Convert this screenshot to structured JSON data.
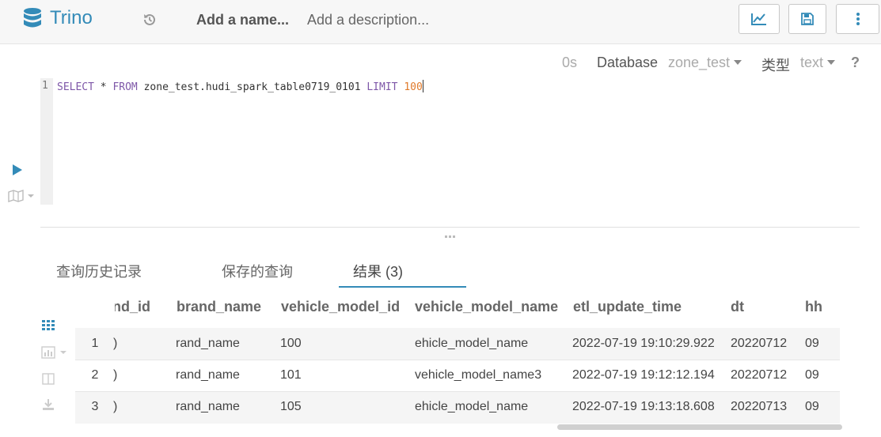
{
  "app": {
    "title": "Trino",
    "icon": "database-icon"
  },
  "header": {
    "name_placeholder": "Add a name...",
    "description_placeholder": "Add a description...",
    "buttons": [
      {
        "name": "chart-button",
        "icon": "line-chart-icon"
      },
      {
        "name": "save-button",
        "icon": "save-icon"
      },
      {
        "name": "more-button",
        "icon": "vertical-dots-icon"
      }
    ]
  },
  "editor": {
    "elapsed": "0s",
    "database_label": "Database",
    "database_value": "zone_test",
    "type_label": "类型",
    "type_value": "text",
    "help": "?",
    "line_number": "1",
    "query_parts": {
      "select": "SELECT",
      "star": " * ",
      "from": "FROM",
      "table": " zone_test.hudi_spark_table0719_0101 ",
      "limit": "LIMIT",
      "space": " ",
      "limit_value": "100"
    }
  },
  "tabs": [
    {
      "label": "查询历史记录",
      "active": false
    },
    {
      "label": "保存的查询",
      "active": false
    },
    {
      "label": "结果 (3)",
      "active": true
    }
  ],
  "results": {
    "columns": [
      "and_id",
      "brand_name",
      "vehicle_model_id",
      "vehicle_model_name",
      "etl_update_time",
      "dt",
      "hh"
    ],
    "rows": [
      {
        "num": "1",
        "cells": [
          ")",
          "rand_name",
          "100",
          "ehicle_model_name",
          "2022-07-19 19:10:29.922",
          "20220712",
          "09"
        ]
      },
      {
        "num": "2",
        "cells": [
          ")",
          "rand_name",
          "101",
          "vehicle_model_name3",
          "2022-07-19 19:12:12.194",
          "20220712",
          "09"
        ]
      },
      {
        "num": "3",
        "cells": [
          ")",
          "rand_name",
          "105",
          "ehicle_model_name",
          "2022-07-19 19:13:18.608",
          "20220713",
          "09"
        ]
      }
    ]
  },
  "colors": {
    "accent": "#338bb8",
    "keyword": "#7e57a8",
    "number": "#e07a2a"
  }
}
